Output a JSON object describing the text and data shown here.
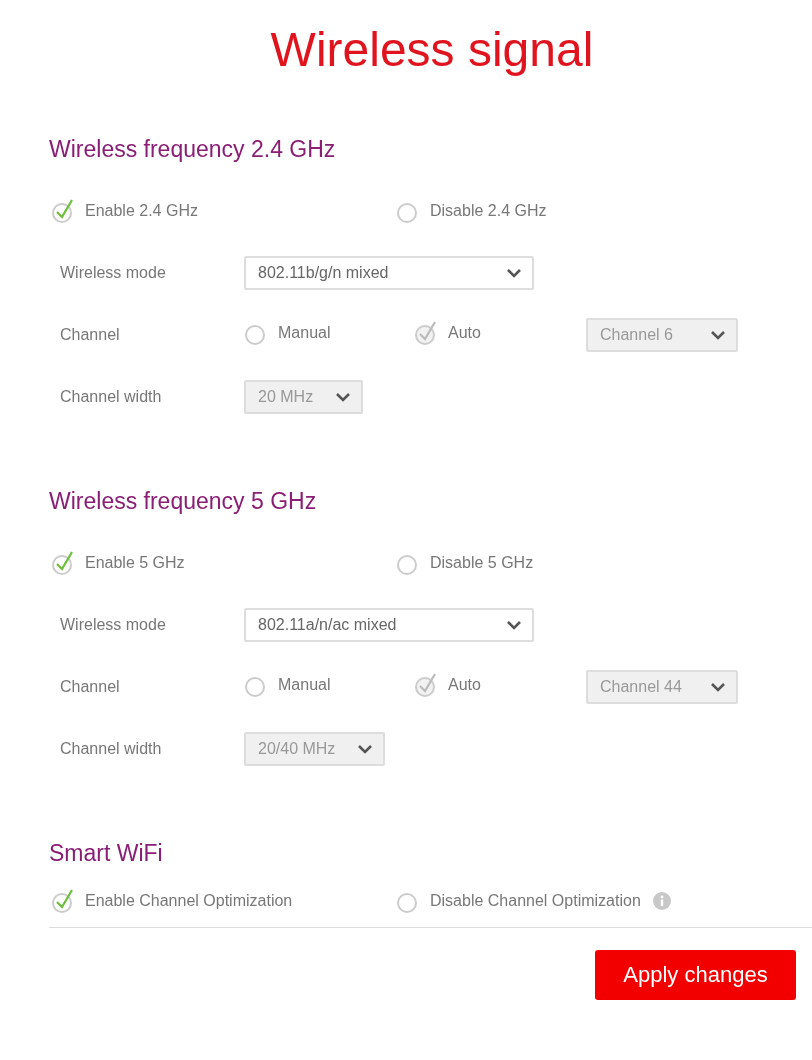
{
  "title": "Wireless signal",
  "sections": [
    {
      "heading": "Wireless frequency 2.4 GHz",
      "toggle": [
        {
          "label": "Enable 2.4 GHz",
          "selected": true,
          "disabled": false
        },
        {
          "label": "Disable 2.4 GHz",
          "selected": false,
          "disabled": false
        }
      ],
      "rows": [
        {
          "kind": "mode",
          "label": "Wireless mode",
          "select": {
            "value": "802.11b/g/n mixed",
            "disabled": false
          }
        },
        {
          "kind": "channel",
          "label": "Channel",
          "options": [
            {
              "label": "Manual",
              "selected": false,
              "disabled": false
            },
            {
              "label": "Auto",
              "selected": true,
              "disabled": true
            }
          ],
          "select": {
            "value": "Channel 6",
            "disabled": true
          }
        },
        {
          "kind": "width",
          "label": "Channel width",
          "select": {
            "value": "20 MHz",
            "disabled": true
          }
        }
      ]
    },
    {
      "heading": "Wireless frequency 5 GHz",
      "toggle": [
        {
          "label": "Enable 5 GHz",
          "selected": true,
          "disabled": false
        },
        {
          "label": "Disable 5 GHz",
          "selected": false,
          "disabled": false
        }
      ],
      "rows": [
        {
          "kind": "mode",
          "label": "Wireless mode",
          "select": {
            "value": "802.11a/n/ac mixed",
            "disabled": false
          }
        },
        {
          "kind": "channel",
          "label": "Channel",
          "options": [
            {
              "label": "Manual",
              "selected": false,
              "disabled": false
            },
            {
              "label": "Auto",
              "selected": true,
              "disabled": true
            }
          ],
          "select": {
            "value": "Channel 44",
            "disabled": true
          }
        },
        {
          "kind": "width",
          "label": "Channel width",
          "select": {
            "value": "20/40 MHz",
            "disabled": true
          }
        }
      ]
    },
    {
      "heading": "Smart WiFi",
      "info": true,
      "toggle": [
        {
          "label": "Enable Channel Optimization",
          "selected": true,
          "disabled": false
        },
        {
          "label": "Disable Channel Optimization",
          "selected": false,
          "disabled": false
        }
      ]
    }
  ],
  "apply_button": "Apply changes"
}
